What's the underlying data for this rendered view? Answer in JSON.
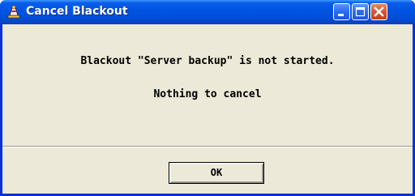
{
  "window": {
    "title": "Cancel Blackout",
    "app_icon": "blackout-app-icon",
    "controls": {
      "minimize_icon": "minimize-icon",
      "maximize_icon": "maximize-icon",
      "close_icon": "close-icon"
    }
  },
  "dialog": {
    "message_line1": "Blackout \"Server backup\" is not started.",
    "message_line2": "Nothing to cancel",
    "ok_label": "OK"
  },
  "colors": {
    "titlebar": "#0054e3",
    "client_bg": "#ece9d8",
    "close_button": "#d85a36",
    "text": "#000000"
  }
}
